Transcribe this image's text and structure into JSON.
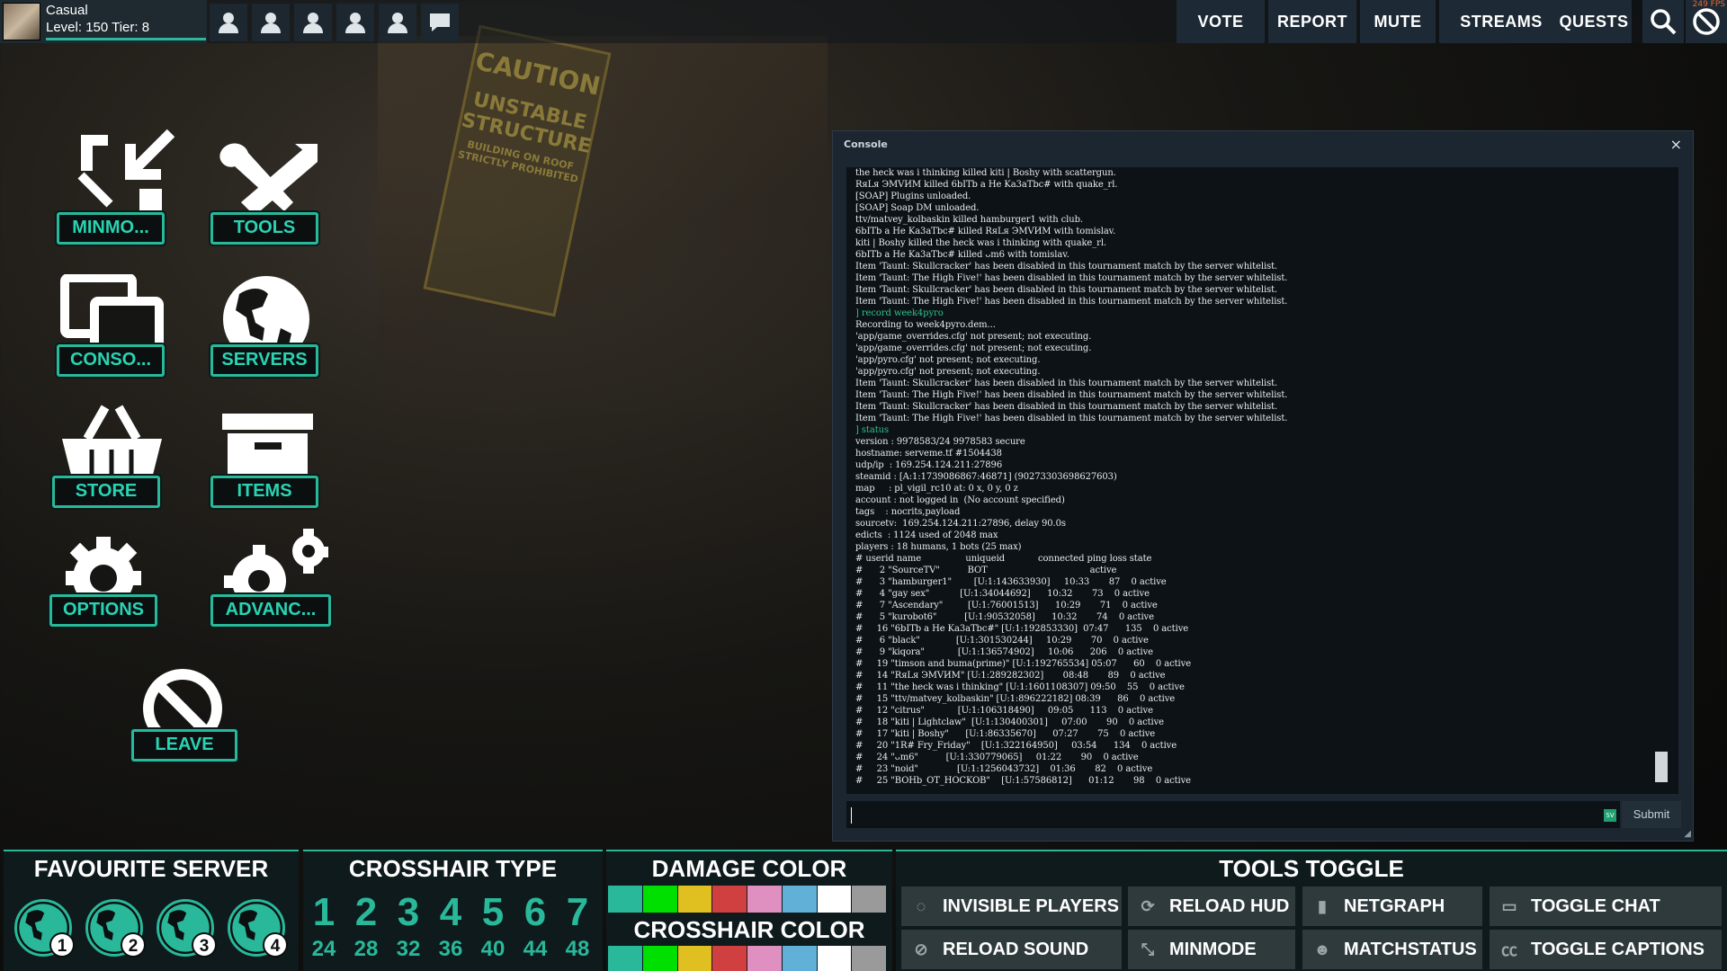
{
  "player": {
    "name": "Casual",
    "level": "Level: 150 Tier: 8"
  },
  "fps": "249 FPS",
  "topnav": {
    "vote": "VOTE",
    "report": "REPORT",
    "mute": "MUTE",
    "streams": "STREAMS",
    "quests": "QUESTS"
  },
  "menu": {
    "minmode": "MINMO...",
    "tools": "TOOLS",
    "console": "CONSO...",
    "servers": "SERVERS",
    "store": "STORE",
    "items": "ITEMS",
    "options": "OPTIONS",
    "advanced": "ADVANC...",
    "leave": "LEAVE"
  },
  "console": {
    "title": "Console",
    "close": "×",
    "submit": "Submit",
    "badge": "SV",
    "lines": [
      {
        "t": "the heck was i thinking killed kiti | Boshy with scattergun."
      },
      {
        "t": "RяLя ЭМVИM killed 6bITb a He Ka3aTbc# with quake_rl."
      },
      {
        "t": "[SOAP] Plugins unloaded."
      },
      {
        "t": "[SOAP] Soap DM unloaded."
      },
      {
        "t": "ttv/matvey_kolbaskin killed hamburger1 with club."
      },
      {
        "t": "6bITb a He Ka3aTbc# killed RяLя ЭМVИM with tomislav."
      },
      {
        "t": "kiti | Boshy killed the heck was i thinking with quake_rl."
      },
      {
        "t": "6bITb a He Ka3aTbc# killed ᴗm6 with tomislav."
      },
      {
        "t": "Item 'Taunt: Skullcracker' has been disabled in this tournament match by the server whitelist."
      },
      {
        "t": "Item 'Taunt: The High Five!' has been disabled in this tournament match by the server whitelist."
      },
      {
        "t": "Item 'Taunt: Skullcracker' has been disabled in this tournament match by the server whitelist."
      },
      {
        "t": "Item 'Taunt: The High Five!' has been disabled in this tournament match by the server whitelist."
      },
      {
        "t": "] record week4pyro",
        "cmd": true
      },
      {
        "t": "Recording to week4pyro.dem..."
      },
      {
        "t": "'app/game_overrides.cfg' not present; not executing."
      },
      {
        "t": "'app/game_overrides.cfg' not present; not executing."
      },
      {
        "t": "'app/pyro.cfg' not present; not executing."
      },
      {
        "t": "'app/pyro.cfg' not present; not executing."
      },
      {
        "t": "Item 'Taunt: Skullcracker' has been disabled in this tournament match by the server whitelist."
      },
      {
        "t": "Item 'Taunt: The High Five!' has been disabled in this tournament match by the server whitelist."
      },
      {
        "t": "Item 'Taunt: Skullcracker' has been disabled in this tournament match by the server whitelist."
      },
      {
        "t": "Item 'Taunt: The High Five!' has been disabled in this tournament match by the server whitelist."
      },
      {
        "t": "] status",
        "cmd": true
      },
      {
        "t": "version : 9978583/24 9978583 secure"
      },
      {
        "t": "hostname: serveme.tf #1504438"
      },
      {
        "t": "udp/ip  : 169.254.124.211:27896"
      },
      {
        "t": "steamid : [A:1:1739086867:46871] (90273303698627603)"
      },
      {
        "t": "map     : pl_vigil_rc10 at: 0 x, 0 y, 0 z"
      },
      {
        "t": "account : not logged in  (No account specified)"
      },
      {
        "t": "tags    : nocrits,payload"
      },
      {
        "t": "sourcetv:  169.254.124.211:27896, delay 90.0s"
      },
      {
        "t": "edicts  : 1124 used of 2048 max"
      },
      {
        "t": "players : 18 humans, 1 bots (25 max)"
      },
      {
        "t": "# userid name                uniqueid            connected ping loss state"
      },
      {
        "t": "#      2 \"SourceTV\"          BOT                                     active"
      },
      {
        "t": "#      3 \"hamburger1\"        [U:1:143633930]     10:33       87    0 active"
      },
      {
        "t": "#      4 \"gay sex\"           [U:1:34044692]      10:32       73    0 active"
      },
      {
        "t": "#      7 \"Ascendary\"         [U:1:76001513]      10:29       71    0 active"
      },
      {
        "t": "#      5 \"kurobot6\"          [U:1:90532058]      10:32       74    0 active"
      },
      {
        "t": "#     16 \"6bITb a He Ka3aTbc#\" [U:1:192853330]  07:47      135    0 active"
      },
      {
        "t": "#      6 \"black\"             [U:1:301530244]     10:29       70    0 active"
      },
      {
        "t": "#      9 \"kiqora\"            [U:1:136574902]     10:06      206    0 active"
      },
      {
        "t": "#     19 \"timson and buma(prime)\" [U:1:192765534] 05:07      60    0 active"
      },
      {
        "t": "#     14 \"RяLя ЭМVИM\" [U:1:289282302]       08:48       89    0 active"
      },
      {
        "t": "#     11 \"the heck was i thinking\" [U:1:1601108307] 09:50    55    0 active"
      },
      {
        "t": "#     15 \"ttv/matvey_kolbaskin\" [U:1:896222182] 08:39      86    0 active"
      },
      {
        "t": "#     12 \"citrus\"            [U:1:106318490]     09:05      113    0 active"
      },
      {
        "t": "#     18 \"kiti | Lightclaw\"  [U:1:130400301]     07:00       90    0 active"
      },
      {
        "t": "#     17 \"kiti | Boshy\"      [U:1:86335670]      07:27       75    0 active"
      },
      {
        "t": "#     20 \"1R# Fry_Friday\"    [U:1:322164950]     03:54      134    0 active"
      },
      {
        "t": "#     24 \"ᴗm6\"          [U:1:330779065]     01:22       90    0 active"
      },
      {
        "t": "#     23 \"noid\"              [U:1:1256043732]    01:36       82    0 active"
      },
      {
        "t": "#     25 \"BOHb_OT_HOCKOB\"    [U:1:57586812]      01:12       98    0 active"
      }
    ]
  },
  "bottom": {
    "fav_title": "FAVOURITE SERVER",
    "fav_numbers": [
      "1",
      "2",
      "3",
      "4"
    ],
    "crosshair_type_title": "CROSSHAIR TYPE",
    "crosshair_types": [
      "1",
      "2",
      "3",
      "4",
      "5",
      "6",
      "7"
    ],
    "crosshair_sizes": [
      "24",
      "28",
      "32",
      "36",
      "40",
      "44",
      "48"
    ],
    "damage_title": "DAMAGE COLOR",
    "crosshair_color_title": "CROSSHAIR COLOR",
    "swatches": [
      "#29b89a",
      "#00e000",
      "#e0c020",
      "#d04040",
      "#e090c0",
      "#60b0d8",
      "#ffffff",
      "#9a9a9a"
    ],
    "tools_title": "TOOLS TOGGLE",
    "tools": {
      "invisible_players": "INVISIBLE PLAYERS",
      "reload_hud": "RELOAD HUD",
      "netgraph": "NETGRAPH",
      "toggle_chat": "TOGGLE CHAT",
      "reload_sound": "RELOAD SOUND",
      "minmode": "MINMODE",
      "matchstatus": "MATCHSTATUS",
      "toggle_captions": "TOGGLE CAPTIONS"
    }
  },
  "background": {
    "sign_lines": [
      "CAUTION",
      "UNSTABLE",
      "STRUCTURE",
      "BUILDING ON ROOF",
      "STRICTLY PROHIBITED"
    ]
  }
}
